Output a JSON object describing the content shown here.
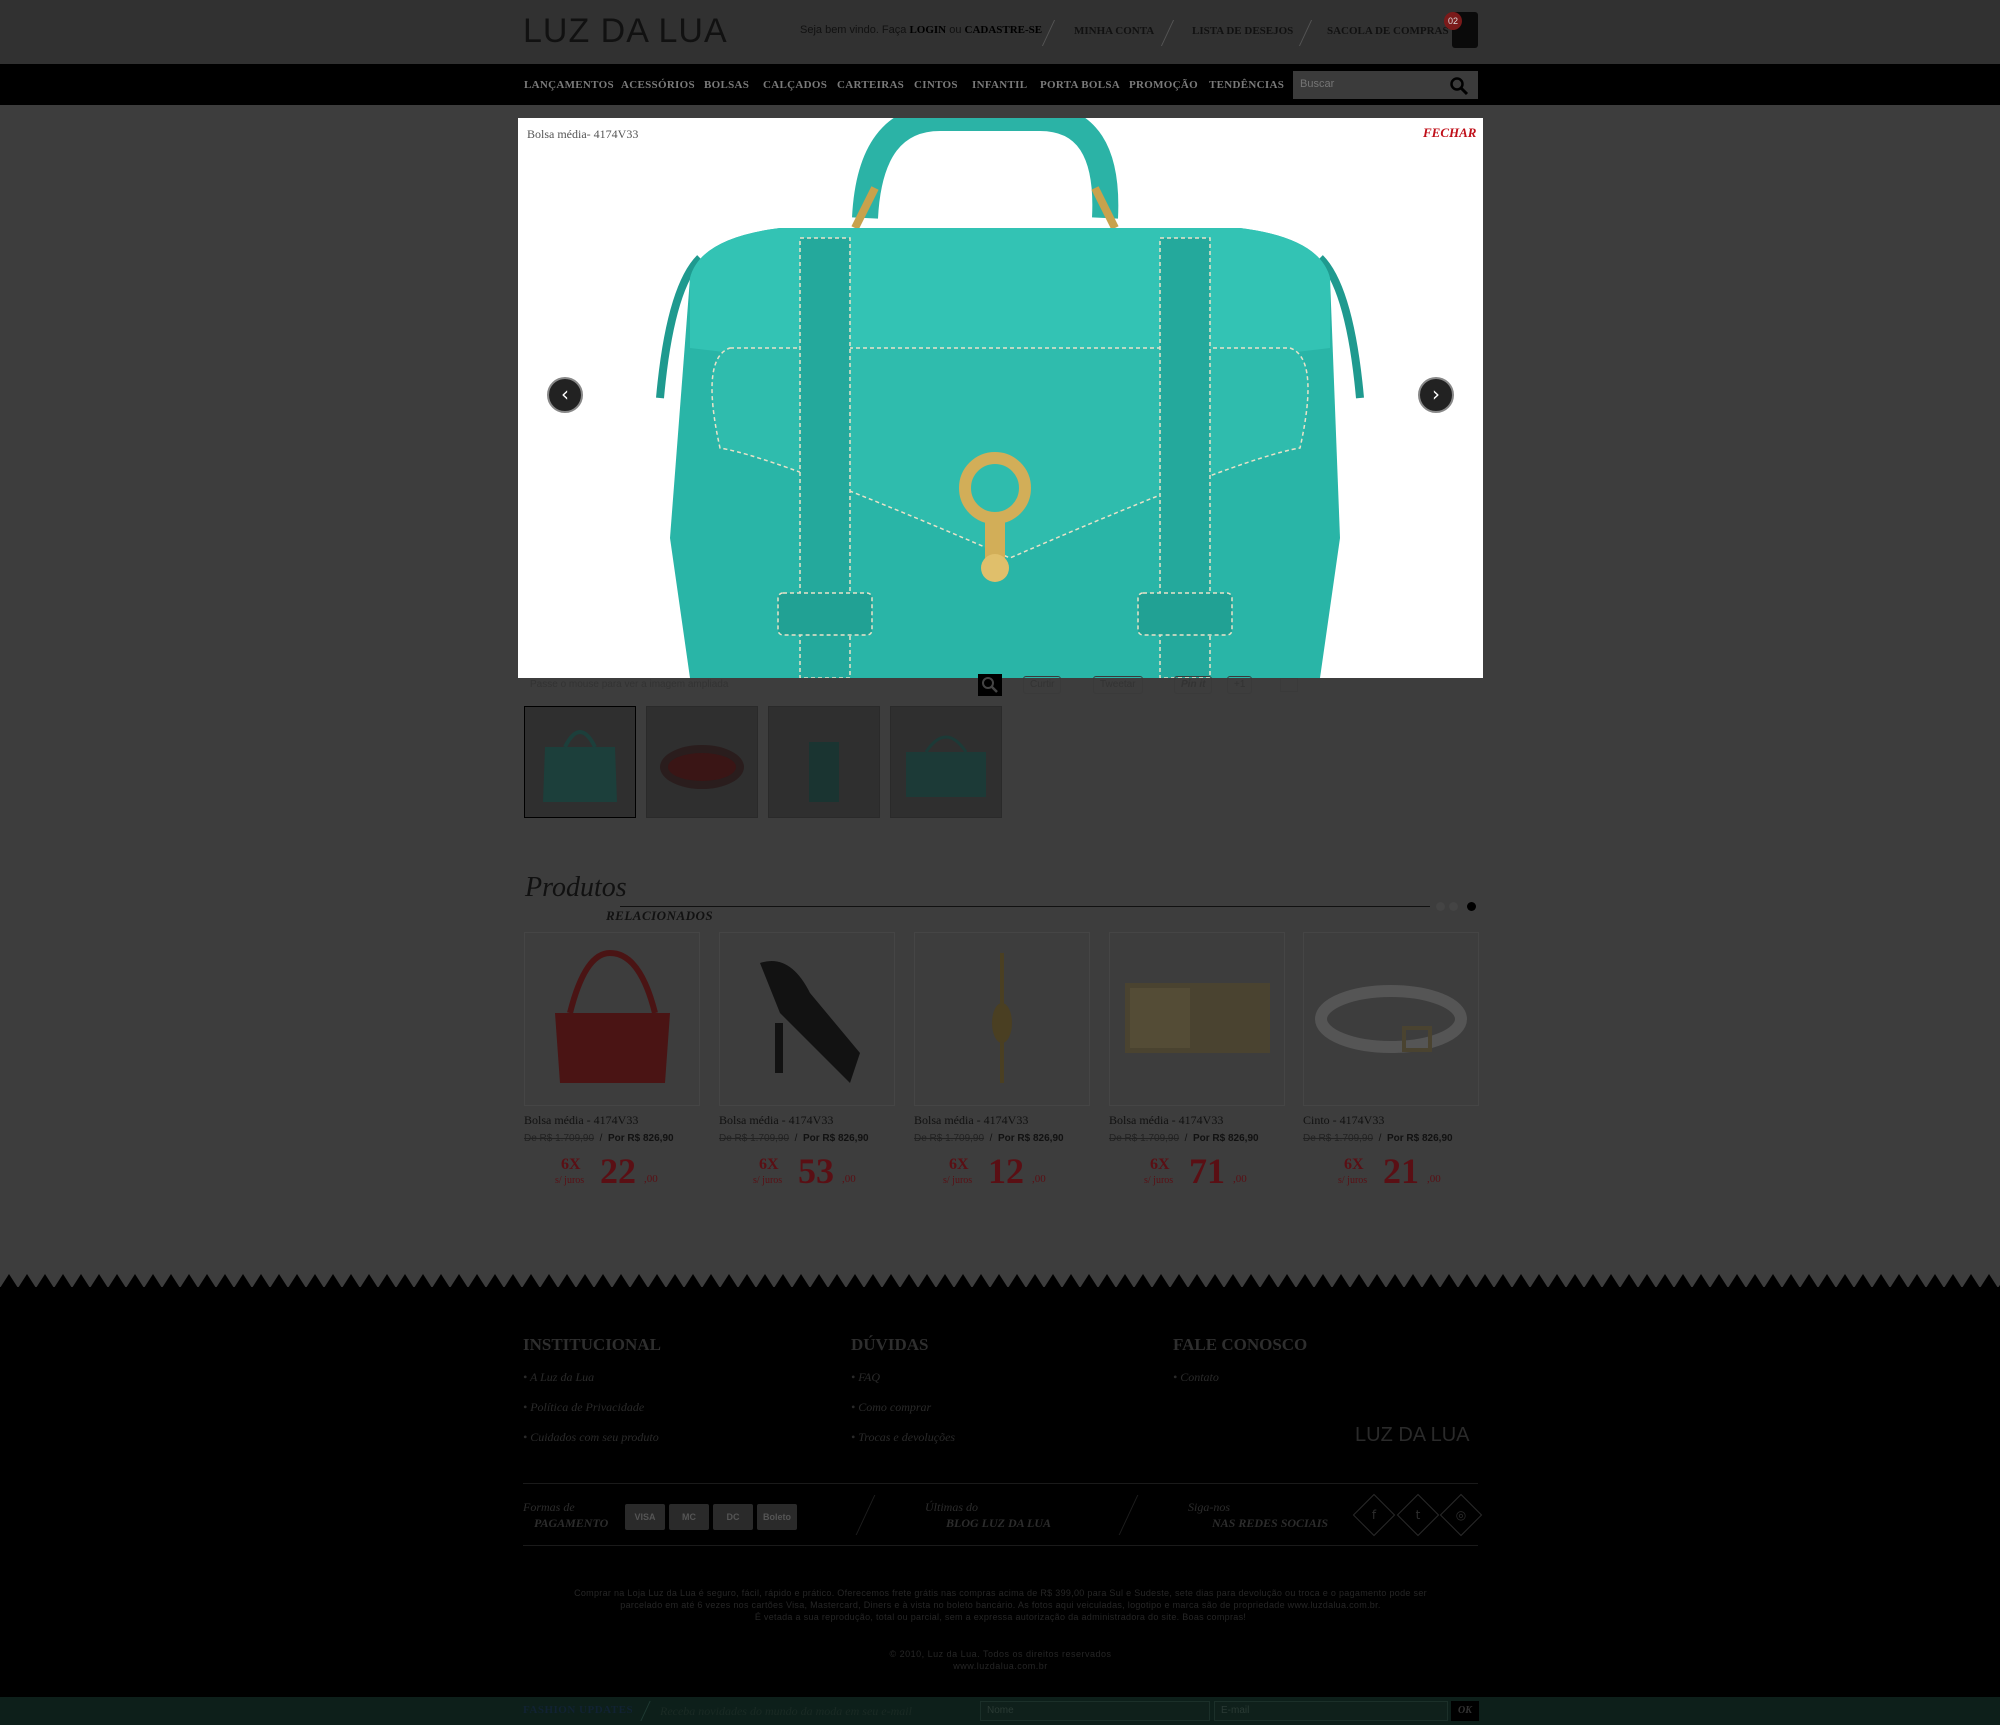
{
  "header": {
    "logo": "LUZ DA LUA",
    "welcome_prefix": "Seja bem vindo. Faça ",
    "login": "LOGIN",
    "or": " ou ",
    "register": "CADASTRE-SE",
    "links": [
      "MINHA CONTA",
      "LISTA DE DESEJOS",
      "SACOLA DE COMPRAS"
    ],
    "cart_count": "02"
  },
  "nav": {
    "items": [
      "LANÇAMENTOS",
      "ACESSÓRIOS",
      "BOLSAS",
      "CALÇADOS",
      "CARTEIRAS",
      "CINTOS",
      "INFANTIL",
      "PORTA BOLSA",
      "PROMOÇÃO",
      "TENDÊNCIAS"
    ],
    "search_placeholder": "Buscar"
  },
  "modal": {
    "title": "Bolsa média- 4174V33",
    "close": "FECHAR",
    "prev": "‹",
    "next": "›"
  },
  "product": {
    "zoom_hint": "Passe o mouse para ver a imagem ampliada",
    "social": [
      "Curtir",
      "Tweetar",
      "Pin it",
      "+1"
    ]
  },
  "related": {
    "title": "Produtos",
    "subtitle": "RELACIONADOS",
    "items": [
      {
        "name": "Bolsa média - 4174V33",
        "old": "De R$ 1.709,90",
        "sep": "/",
        "new": "Por R$ 826,90",
        "times": "6X",
        "juros": "s/ juros",
        "value": "22",
        "cents": ",00"
      },
      {
        "name": "Bolsa média - 4174V33",
        "old": "De R$ 1.709,90",
        "sep": "/",
        "new": "Por R$ 826,90",
        "times": "6X",
        "juros": "s/ juros",
        "value": "53",
        "cents": ",00"
      },
      {
        "name": "Bolsa média - 4174V33",
        "old": "De R$ 1.709,90",
        "sep": "/",
        "new": "Por R$ 826,90",
        "times": "6X",
        "juros": "s/ juros",
        "value": "12",
        "cents": ",00"
      },
      {
        "name": "Bolsa média - 4174V33",
        "old": "De R$ 1.709,90",
        "sep": "/",
        "new": "Por R$ 826,90",
        "times": "6X",
        "juros": "s/ juros",
        "value": "71",
        "cents": ",00"
      },
      {
        "name": "Cinto - 4174V33",
        "old": "De R$ 1.709,90",
        "sep": "/",
        "new": "Por R$ 826,90",
        "times": "6X",
        "juros": "s/ juros",
        "value": "21",
        "cents": ",00"
      }
    ]
  },
  "footer": {
    "institucional": {
      "title": "INSTITUCIONAL",
      "links": [
        "• A Luz da Lua",
        "• Política de Privacidade",
        "• Cuidados com seu produto"
      ]
    },
    "duvidas": {
      "title": "DÚVIDAS",
      "links": [
        "• FAQ",
        "• Como comprar",
        "• Trocas e devoluções"
      ]
    },
    "fale": {
      "title": "FALE CONOSCO",
      "links": [
        "• Contato"
      ]
    },
    "logo": "LUZ DA LUA",
    "pay_label_1": "Formas de",
    "pay_label_2": "PAGAMENTO",
    "cards": [
      "VISA",
      "MC",
      "DC",
      "Boleto"
    ],
    "blog_1": "Últimas do",
    "blog_2": "BLOG LUZ DA LUA",
    "social_1": "Siga-nos",
    "social_2": "NAS REDES SOCIAIS",
    "legal_1": "Comprar na Loja Luz da Lua é seguro, fácil, rápido e prático. Oferecemos frete grátis nas compras acima de R$ 399,00 para Sul e Sudeste, sete dias para devolução ou troca e o pagamento pode ser",
    "legal_2": "parcelado em até 6 vezes nos cartões Visa, Mastercard, Diners e à vista no boleto bancário. As fotos aqui veiculadas, logotipo e marca são de propriedade www.luzdalua.com.br.",
    "legal_3": "É vetada a sua reprodução, total ou parcial, sem a expressa autorização da administradora do site. Boas compras!",
    "copy_1": "© 2010, Luz da Lua. Todos os direitos reservados",
    "copy_2": "www.luzdalua.com.br"
  },
  "newsletter": {
    "title": "FASHION UPDATES",
    "desc": "Receba novidades do mundo da moda em seu e-mail",
    "name_placeholder": "Nome",
    "email_placeholder": "E-mail",
    "ok": "OK"
  }
}
